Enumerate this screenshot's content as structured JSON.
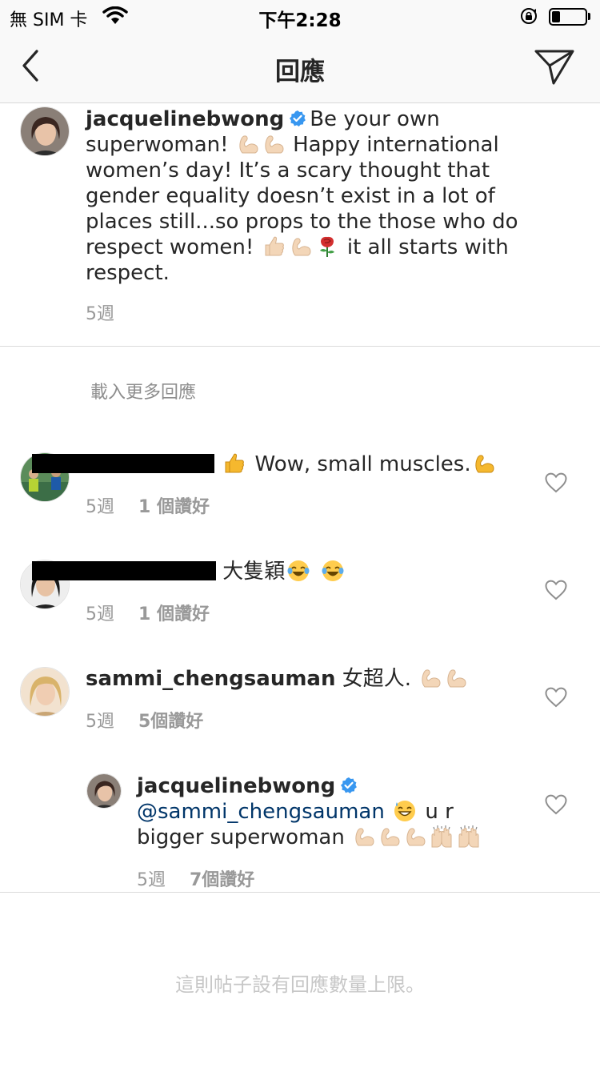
{
  "status_bar": {
    "carrier": "無 SIM 卡",
    "time": "下午2:28",
    "battery_level": 0.25
  },
  "nav": {
    "title": "回應",
    "back_icon": "chevron-left-icon",
    "send_icon": "paper-plane-icon"
  },
  "caption": {
    "username": "jacquelinebwong",
    "text_1": "Be your own superwoman!",
    "text_2": "Happy international women’s day! It’s a scary thought that gender equality doesn’t exist in a lot of places still...so props to the those who do respect women!",
    "text_3": "it all starts with respect.",
    "time": "5週"
  },
  "load_more": "載入更多回應",
  "comments": [
    {
      "username": "",
      "text": "Wow, small muscles.",
      "time": "5週",
      "likes": "1 個讚好"
    },
    {
      "username": "",
      "text": "大隻穎",
      "time": "5週",
      "likes": "1 個讚好"
    },
    {
      "username": "sammi_chengsauman",
      "text": "女超人.",
      "time": "5週",
      "likes": "5個讚好"
    }
  ],
  "reply": {
    "username": "jacquelinebwong",
    "mention": "@sammi_chengsauman",
    "text_1": "u r",
    "text_2": "bigger superwoman",
    "time": "5週",
    "likes": "7個讚好"
  },
  "limit_note": "這則帖子設有回應數量上限。",
  "colors": {
    "verified_blue": "#3897f0",
    "muscle_light": "#f3d6b8",
    "muscle_yellow": "#f5b82e",
    "meta_gray": "#999999",
    "mention_blue": "#003569"
  }
}
